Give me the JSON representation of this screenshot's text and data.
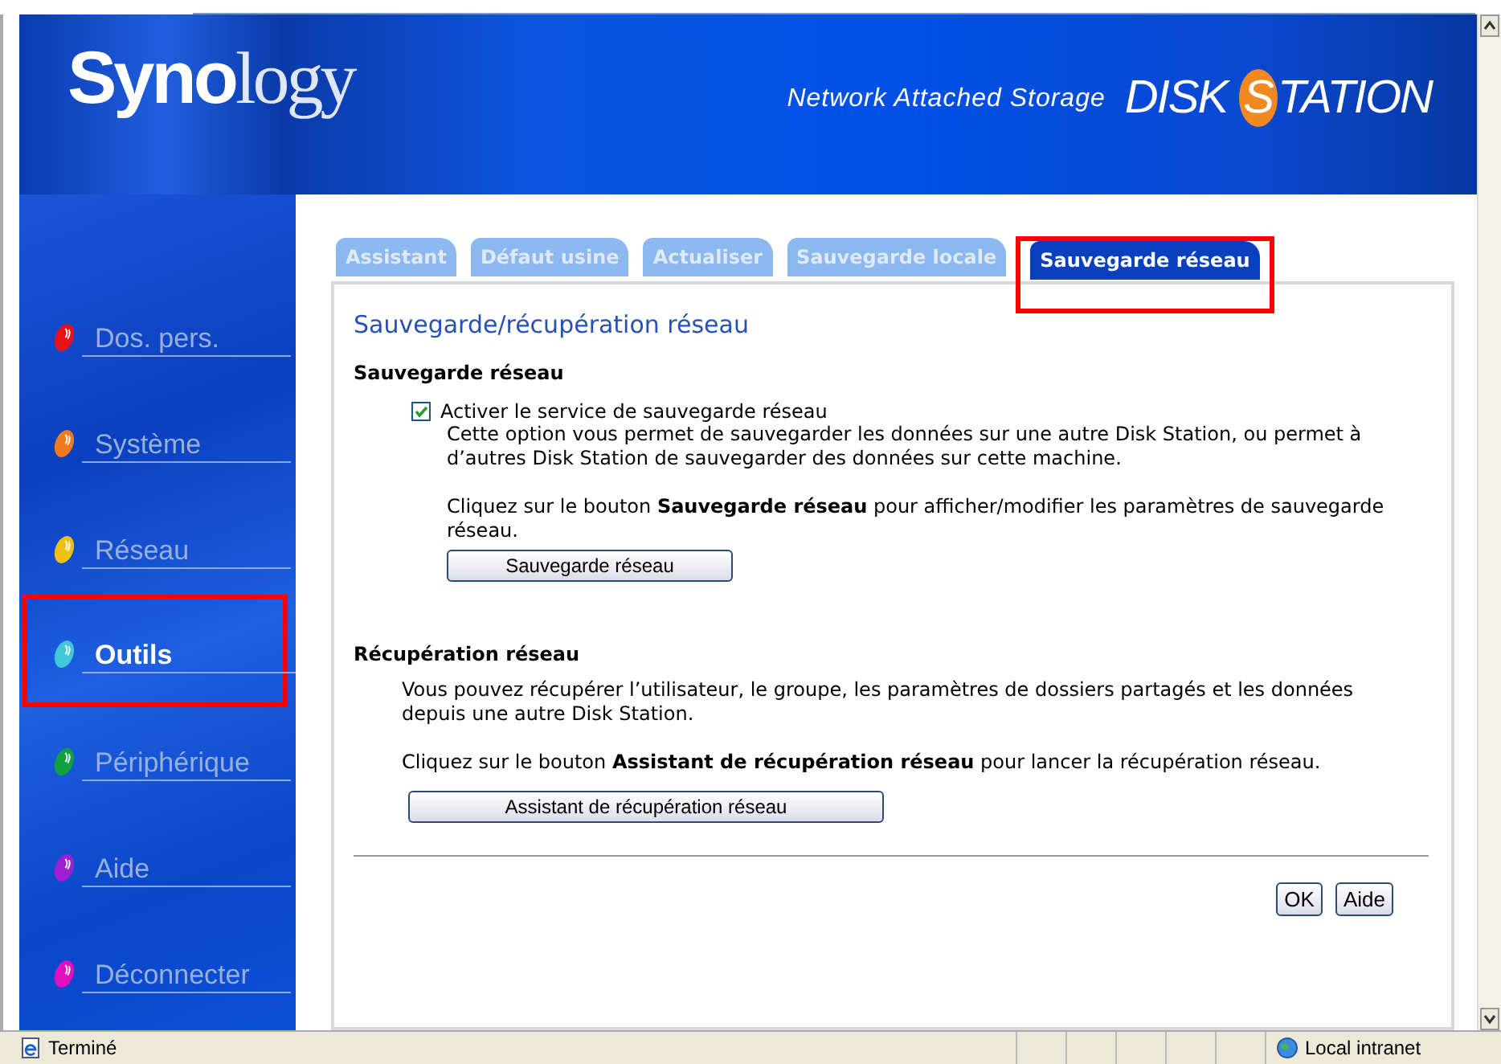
{
  "header": {
    "logo_bold": "Syno",
    "logo_light": "logy",
    "tagline": "Network Attached Storage",
    "product_start": "DISK ",
    "product_highlight": "S",
    "product_end": "TATION"
  },
  "sidebar": {
    "items": [
      {
        "label": "Dos. pers.",
        "color": "#e8101a",
        "selected": false,
        "highlighted": false
      },
      {
        "label": "Système",
        "color": "#f07a20",
        "selected": false,
        "highlighted": false
      },
      {
        "label": "Réseau",
        "color": "#f0c010",
        "selected": false,
        "highlighted": false
      },
      {
        "label": "Outils",
        "color": "#40c8d8",
        "selected": true,
        "highlighted": true
      },
      {
        "label": "Périphérique",
        "color": "#10a040",
        "selected": false,
        "highlighted": false
      },
      {
        "label": "Aide",
        "color": "#9a20d0",
        "selected": false,
        "highlighted": false
      },
      {
        "label": "Déconnecter",
        "color": "#e010c0",
        "selected": false,
        "highlighted": false
      }
    ]
  },
  "tabs": [
    {
      "label": "Assistant",
      "selected": false,
      "highlighted": false
    },
    {
      "label": "Défaut usine",
      "selected": false,
      "highlighted": false
    },
    {
      "label": "Actualiser",
      "selected": false,
      "highlighted": false
    },
    {
      "label": "Sauvegarde locale",
      "selected": false,
      "highlighted": false
    },
    {
      "label": "Sauvegarde réseau",
      "selected": true,
      "highlighted": true
    }
  ],
  "panel": {
    "title": "Sauvegarde/récupération réseau",
    "backup": {
      "heading": "Sauvegarde réseau",
      "checkbox_label": "Activer le service de sauvegarde réseau",
      "checked": true,
      "description": "Cette option vous permet de sauvegarder les données sur une autre Disk Station, ou permet à d’autres Disk Station de sauvegarder des données sur cette machine.",
      "instruction": "Cliquez sur le bouton **Sauvegarde réseau** pour afficher/modifier les paramètres de sauvegarde réseau.",
      "button": "Sauvegarde réseau"
    },
    "restore": {
      "heading": "Récupération réseau",
      "description": "Vous pouvez récupérer l’utilisateur, le groupe, les paramètres de dossiers partagés et les données depuis une autre Disk Station.",
      "instruction": "Cliquez sur le bouton **Assistant de récupération réseau** pour lancer la récupération réseau.",
      "button": "Assistant de récupération réseau"
    },
    "buttons": [
      "OK",
      "Aide"
    ]
  },
  "status_bar": {
    "left": "Terminé",
    "zone": "Local intranet"
  }
}
